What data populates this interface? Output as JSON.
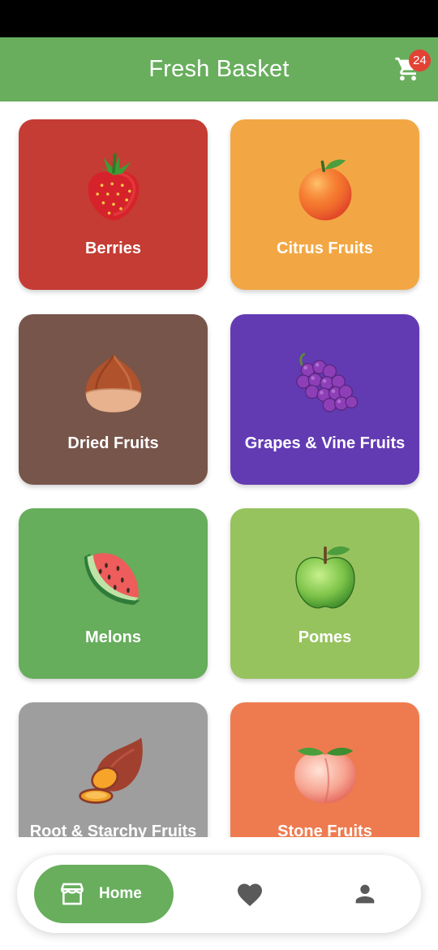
{
  "app": {
    "title": "Fresh Basket",
    "cart_count": "24",
    "primary_color": "#68ae5d",
    "badge_color": "#e34234"
  },
  "categories": [
    {
      "label": "Berries",
      "color": "#c43c33",
      "icon": "strawberry-icon"
    },
    {
      "label": "Citrus Fruits",
      "color": "#f2a744",
      "icon": "orange-icon"
    },
    {
      "label": "Dried Fruits",
      "color": "#77554a",
      "icon": "chestnut-icon"
    },
    {
      "label": "Grapes & Vine Fruits",
      "color": "#623bb3",
      "icon": "grapes-icon"
    },
    {
      "label": "Melons",
      "color": "#66ad5c",
      "icon": "watermelon-icon"
    },
    {
      "label": "Pomes",
      "color": "#97c35f",
      "icon": "green-apple-icon"
    },
    {
      "label": "Root & Starchy Fruits",
      "color": "#9e9e9e",
      "icon": "sweet-potato-icon"
    },
    {
      "label": "Stone Fruits",
      "color": "#ee7b4f",
      "icon": "peach-icon"
    }
  ],
  "bottom_nav": {
    "home_label": "Home",
    "items": [
      "store-icon",
      "heart-icon",
      "person-icon"
    ]
  }
}
